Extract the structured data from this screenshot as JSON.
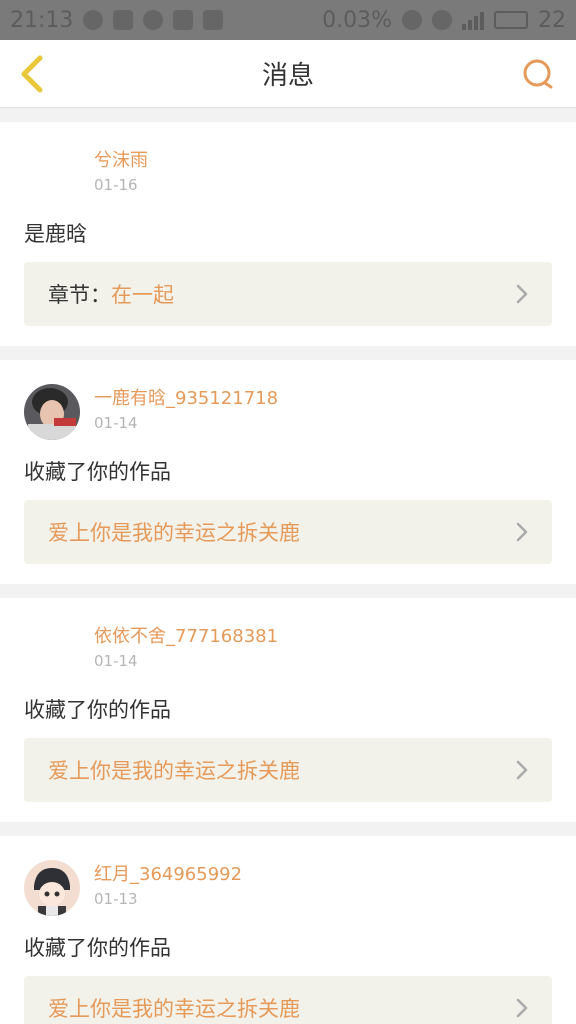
{
  "status_bar": {
    "time": "21:13",
    "battery_percent": "0.03%",
    "signal_strength": 22
  },
  "nav": {
    "title": "消息",
    "back_icon": "chevron-left-icon",
    "search_icon": "search-icon",
    "accent_color": "#e69a5a",
    "back_color": "#e8c83a"
  },
  "messages": [
    {
      "username": "兮沫雨",
      "date": "01-16",
      "text": "是鹿晗",
      "has_avatar": false,
      "work_label": "章节：",
      "work_title": "在一起"
    },
    {
      "username": "一鹿有晗_935121718",
      "date": "01-14",
      "text": "收藏了你的作品",
      "has_avatar": true,
      "work_label": "",
      "work_title": "爱上你是我的幸运之拆关鹿"
    },
    {
      "username": "依依不舍_777168381",
      "date": "01-14",
      "text": "收藏了你的作品",
      "has_avatar": false,
      "work_label": "",
      "work_title": "爱上你是我的幸运之拆关鹿"
    },
    {
      "username": "红月_364965992",
      "date": "01-13",
      "text": "收藏了你的作品",
      "has_avatar": true,
      "work_label": "",
      "work_title": "爱上你是我的幸运之拆关鹿"
    }
  ]
}
